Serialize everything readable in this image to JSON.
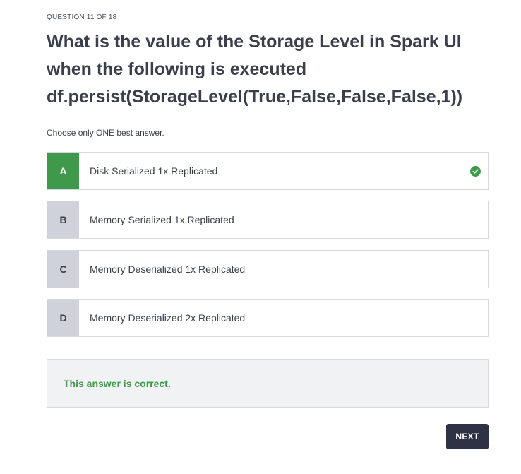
{
  "question": {
    "counter": "QUESTION 11 OF 18",
    "text": "What is the value of the Storage Level in Spark UI when the following is executed df.persist(StorageLevel(True,False,False,False,1))",
    "instruction": "Choose only ONE best answer."
  },
  "options": [
    {
      "letter": "A",
      "label": "Disk Serialized 1x Replicated",
      "selected": true,
      "correct": true
    },
    {
      "letter": "B",
      "label": "Memory Serialized 1x Replicated",
      "selected": false
    },
    {
      "letter": "C",
      "label": "Memory Deserialized 1x Replicated",
      "selected": false
    },
    {
      "letter": "D",
      "label": "Memory Deserialized 2x Replicated",
      "selected": false
    }
  ],
  "feedback": {
    "text": "This answer is correct."
  },
  "buttons": {
    "next_label": "NEXT"
  },
  "colors": {
    "correct_green": "#3e9a4a",
    "letter_bg": "#cfd2da",
    "next_bg": "#2f3145",
    "feedback_bg": "#f1f2f3"
  }
}
